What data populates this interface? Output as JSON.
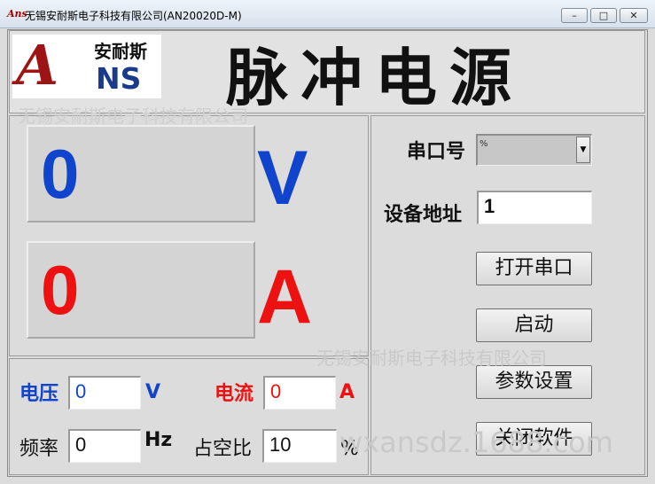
{
  "window": {
    "title": "无锡安耐斯电子科技有限公司(AN20020D-M)",
    "icon_text": "Ans"
  },
  "header": {
    "logo_mark": "A",
    "logo_ns": "NS",
    "logo_cn": "安耐斯",
    "app_title": "脉冲电源"
  },
  "watermarks": [
    "无锡安耐斯电子科技有限公司",
    "无锡安耐斯电子科技有限公司",
    "wxansdz.1688.com"
  ],
  "readouts": {
    "voltage": {
      "value": "0",
      "unit": "V",
      "color": "#1144cc"
    },
    "current": {
      "value": "0",
      "unit": "A",
      "color": "#ee1111"
    }
  },
  "params": {
    "voltage_label": "电压",
    "voltage_value": "0",
    "voltage_unit": "V",
    "current_label": "电流",
    "current_value": "0",
    "current_unit": "A",
    "freq_label": "频率",
    "freq_value": "0",
    "freq_unit": "Hz",
    "duty_label": "占空比",
    "duty_value": "10",
    "duty_unit": "%"
  },
  "serial": {
    "port_label": "串口号",
    "port_prefix": "%",
    "address_label": "设备地址",
    "address_value": "1"
  },
  "buttons": {
    "open_port": "打开串口",
    "start": "启动",
    "settings": "参数设置",
    "close_app": "关闭软件"
  }
}
